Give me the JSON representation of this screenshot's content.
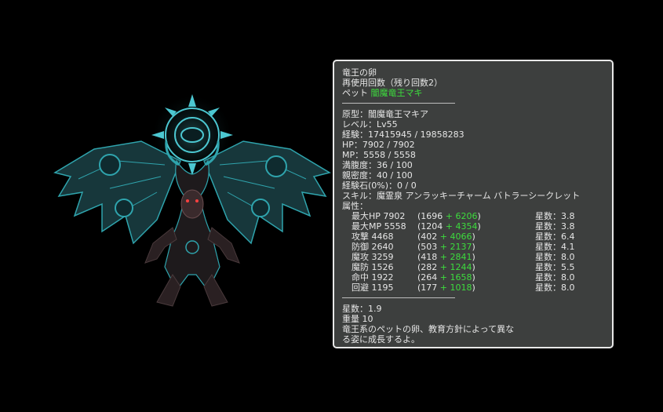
{
  "item": {
    "name": "竜王の卵",
    "uses": "再使用回数（残り回数2）",
    "pet_label": "ペット",
    "pet_name": "闇魔竜王マキ"
  },
  "info": {
    "prototype": "原型：闇魔竜王マキア",
    "level": "レベル：Lv55",
    "exp": "経験：17415945 / 19858283",
    "hp": "HP：7902 / 7902",
    "mp": "MP：5558 / 5558",
    "fullness": "満腹度：36 / 100",
    "affinity": "親密度：40 / 100",
    "exp_stone": "経験石(0%)：0 / 0",
    "skills": "スキル：魔霊泉 アンラッキーチャーム バトラーシークレット",
    "attributes_label": "属性："
  },
  "stats": [
    {
      "name": "最大HP 7902",
      "base": "(1696 ",
      "bonus": "+ 6206",
      "close": ")",
      "stars": "星数：3.8"
    },
    {
      "name": "最大MP 5558",
      "base": "(1204 ",
      "bonus": "+ 4354",
      "close": ")",
      "stars": "星数：3.8"
    },
    {
      "name": "攻撃 4468",
      "base": "(402 ",
      "bonus": "+ 4066",
      "close": ")",
      "stars": "星数：6.4"
    },
    {
      "name": "防御 2640",
      "base": "(503 ",
      "bonus": "+ 2137",
      "close": ")",
      "stars": "星数：4.1"
    },
    {
      "name": "魔攻 3259",
      "base": "(418 ",
      "bonus": "+ 2841",
      "close": ")",
      "stars": "星数：8.0"
    },
    {
      "name": "魔防 1526",
      "base": "(282 ",
      "bonus": "+ 1244",
      "close": ")",
      "stars": "星数：5.5"
    },
    {
      "name": "命中 1922",
      "base": "(264 ",
      "bonus": "+ 1658",
      "close": ")",
      "stars": "星数：8.0"
    },
    {
      "name": "回避 1195",
      "base": "(177 ",
      "bonus": "+ 1018",
      "close": ")",
      "stars": "星数：8.0"
    }
  ],
  "footer": {
    "stars": "星数：1.9",
    "weight": "重量 10",
    "desc1": "竜王系のペットの卵、教育方針によって異な",
    "desc2": "る姿に成長するよ。"
  },
  "colors": {
    "bonus": "#3ddc3d",
    "panel_bg": "#3d3f3e",
    "monster_teal": "#2fa4ad"
  }
}
